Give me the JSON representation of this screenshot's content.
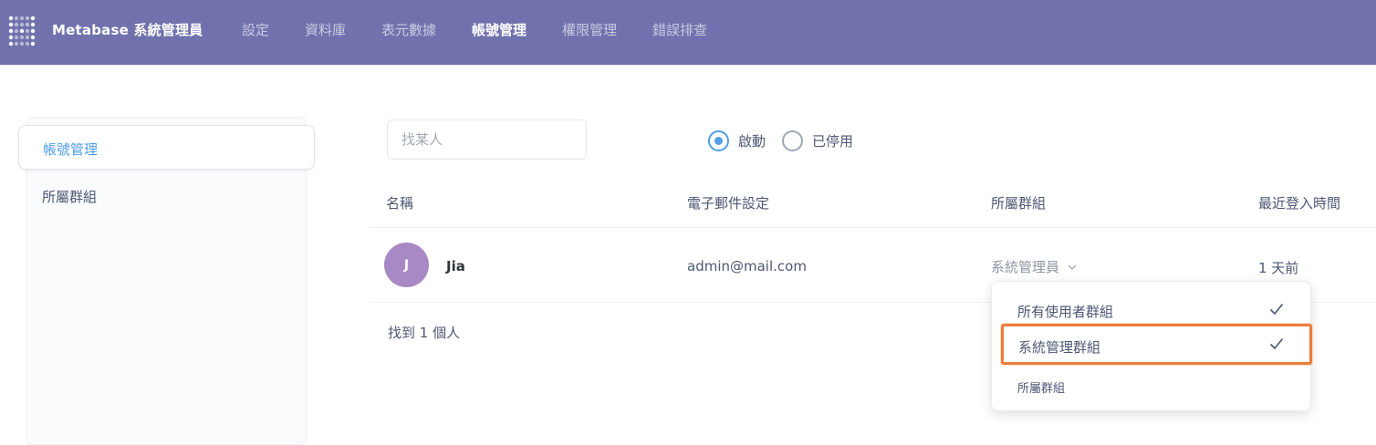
{
  "header": {
    "brand": "Metabase 系統管理員",
    "nav": [
      {
        "label": "設定"
      },
      {
        "label": "資料庫"
      },
      {
        "label": "表元數據"
      },
      {
        "label": "帳號管理",
        "active": true
      },
      {
        "label": "權限管理"
      },
      {
        "label": "錯誤排查"
      }
    ]
  },
  "sidebar": {
    "items": [
      {
        "label": "帳號管理",
        "active": true
      },
      {
        "label": "所屬群組"
      }
    ]
  },
  "toolbar": {
    "search_placeholder": "找某人",
    "filters": [
      {
        "label": "啟動",
        "selected": true
      },
      {
        "label": "已停用",
        "selected": false
      }
    ]
  },
  "table": {
    "columns": [
      "名稱",
      "電子郵件設定",
      "所屬群組",
      "最近登入時間"
    ],
    "rows": [
      {
        "avatar_initial": "J",
        "name": "Jia",
        "email": "admin@mail.com",
        "group": "系統管理員",
        "last_login": "1 天前"
      }
    ],
    "summary": "找到 1 個人"
  },
  "group_dropdown": {
    "options": [
      {
        "label": "所有使用者群組",
        "checked": true
      },
      {
        "label": "系統管理群組",
        "checked": true,
        "highlighted": true
      }
    ],
    "footer": "所屬群組"
  },
  "colors": {
    "nav_bg": "#7172ad",
    "brand_blue": "#509ee3",
    "avatar": "#a989c5",
    "highlight": "#e87e3c"
  }
}
